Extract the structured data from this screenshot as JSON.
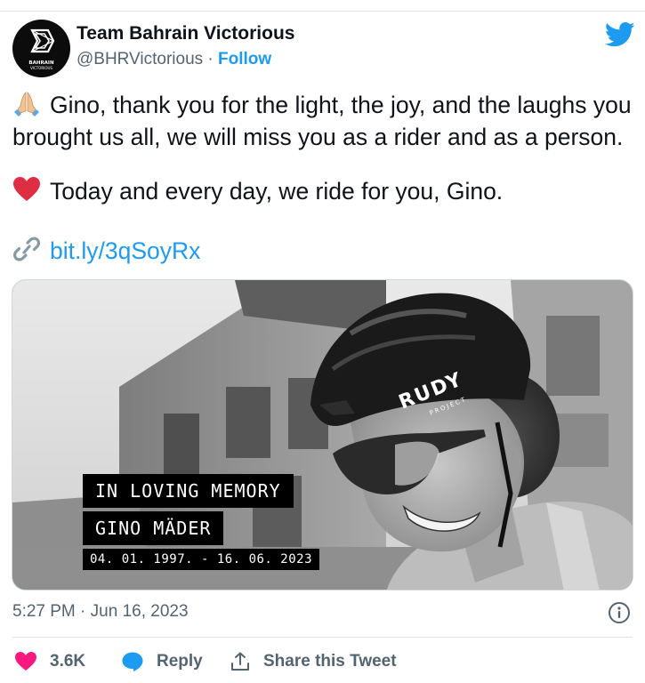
{
  "tweet": {
    "author_name": "Team Bahrain Victorious",
    "handle": "@BHRVictorious",
    "separator": " · ",
    "follow_label": "Follow",
    "avatar_logo_text_1": "BAHRAIN",
    "avatar_logo_text_2": "VICTORIOUS",
    "line1": "Gino, thank you for the light, the joy, and the laughs you",
    "line2": "brought us all, we will miss you as a rider and as a person.",
    "line3": "Today and every day, we ride for you, Gino.",
    "link_text": "bit.ly/3qSoyRx",
    "icons": {
      "prayer": "folded-hands-emoji",
      "heart": "red-heart-emoji",
      "link": "link-icon",
      "platform": "twitter-bird-icon"
    }
  },
  "media": {
    "memory_title": "IN LOVING MEMORY",
    "rider_name": "GINO MÄDER",
    "dates": "04. 01. 1997. - 16. 06. 2023",
    "helmet_brand": "RUDY",
    "helmet_brand_sub": "PROJECT"
  },
  "meta": {
    "time": "5:27 PM",
    "separator": " · ",
    "date": "Jun 16, 2023"
  },
  "actions": {
    "likes": "3.6K",
    "reply_label": "Reply",
    "share_label": "Share this Tweet"
  },
  "colors": {
    "accent": "#1d9bf0",
    "like": "#f91880",
    "text": "#0f1419",
    "muted": "#536471"
  }
}
